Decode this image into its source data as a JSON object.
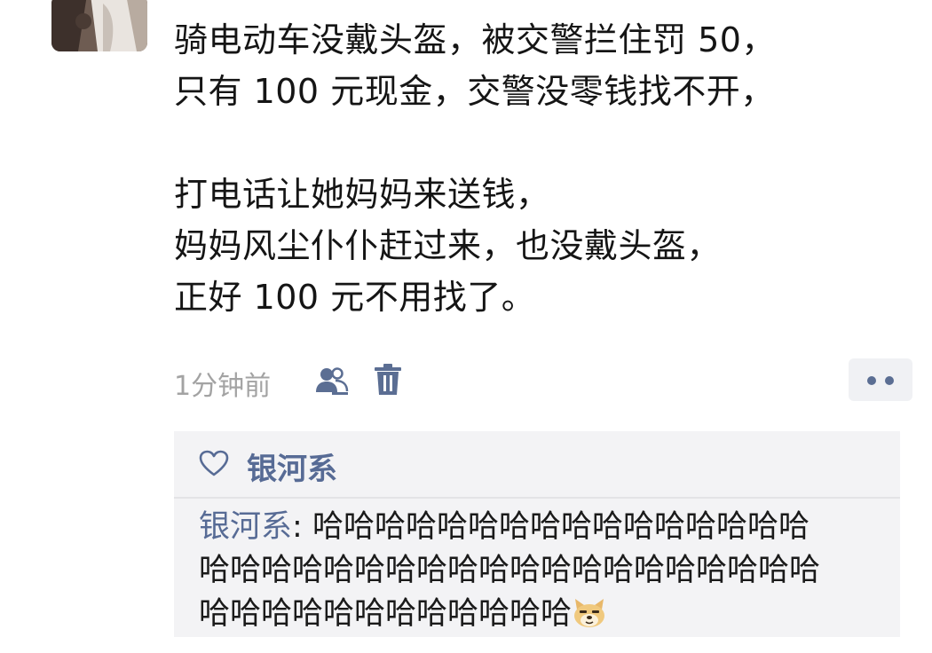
{
  "post": {
    "lines": [
      "骑电动车没戴头盔，被交警拦住罚 50，",
      "只有 100 元现金，交警没零钱找不开，",
      "",
      "打电话让她妈妈来送钱，",
      "妈妈风尘仆仆赶过来，也没戴头盔，",
      "正好 100 元不用找了。"
    ],
    "timestamp": "1分钟前"
  },
  "icons": {
    "friends": "friends-visibility-icon",
    "delete": "trash-icon",
    "more": "more-dots-icon",
    "like": "heart-icon",
    "emoji": "doge-emoji"
  },
  "likes": {
    "names": "银河系"
  },
  "comments": [
    {
      "author": "银河系",
      "separator": ": ",
      "lines": [
        "哈哈哈哈哈哈哈哈哈哈哈哈哈哈哈哈",
        "哈哈哈哈哈哈哈哈哈哈哈哈哈哈哈哈哈哈哈哈",
        "哈哈哈哈哈哈哈哈哈哈哈哈"
      ]
    }
  ],
  "colors": {
    "link_blue": "#576b95",
    "meta_gray": "#a3a3a3",
    "panel_bg": "#f3f3f5"
  }
}
